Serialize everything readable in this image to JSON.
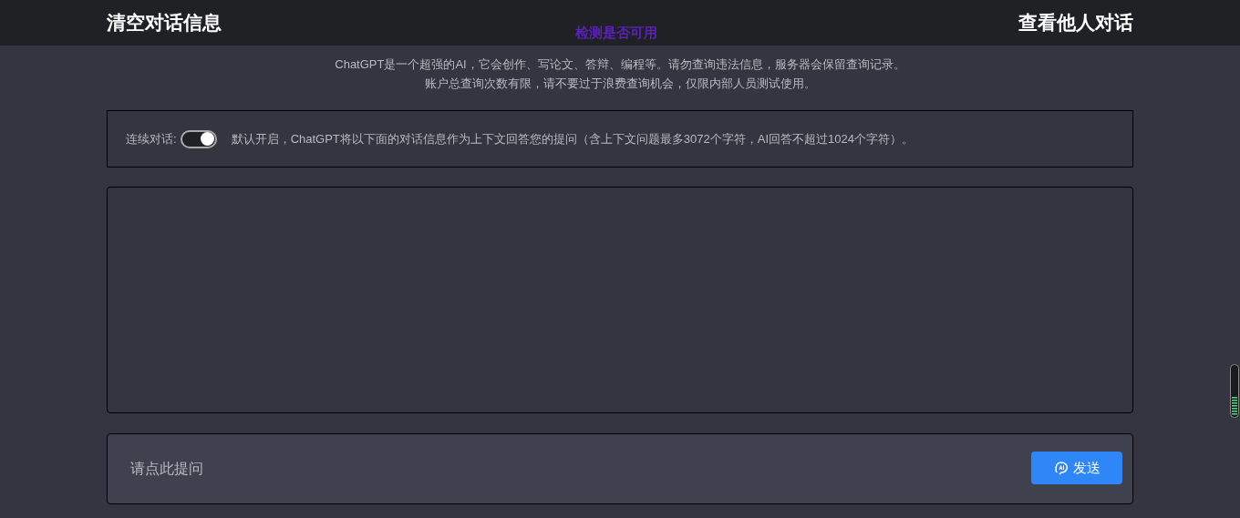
{
  "header": {
    "left_link": "清空对话信息",
    "center_link": "检测是否可用",
    "right_link": "查看他人对话"
  },
  "notice": [
    "ChatGPT是一个超强的AI，它会创作、写论文、答辩、编程等。请勿查询违法信息，服务器会保留查询记录。",
    "账户总查询次数有限，请不要过于浪费查询机会，仅限内部人员测试使用。"
  ],
  "context": {
    "label": "连续对话:",
    "on": true,
    "description": "默认开启，ChatGPT将以下面的对话信息作为上下文回答您的提问（含上下文问题最多3072个字符，AI回答不超过1024个字符）。"
  },
  "input": {
    "placeholder": "请点此提问"
  },
  "send_button": "发送"
}
